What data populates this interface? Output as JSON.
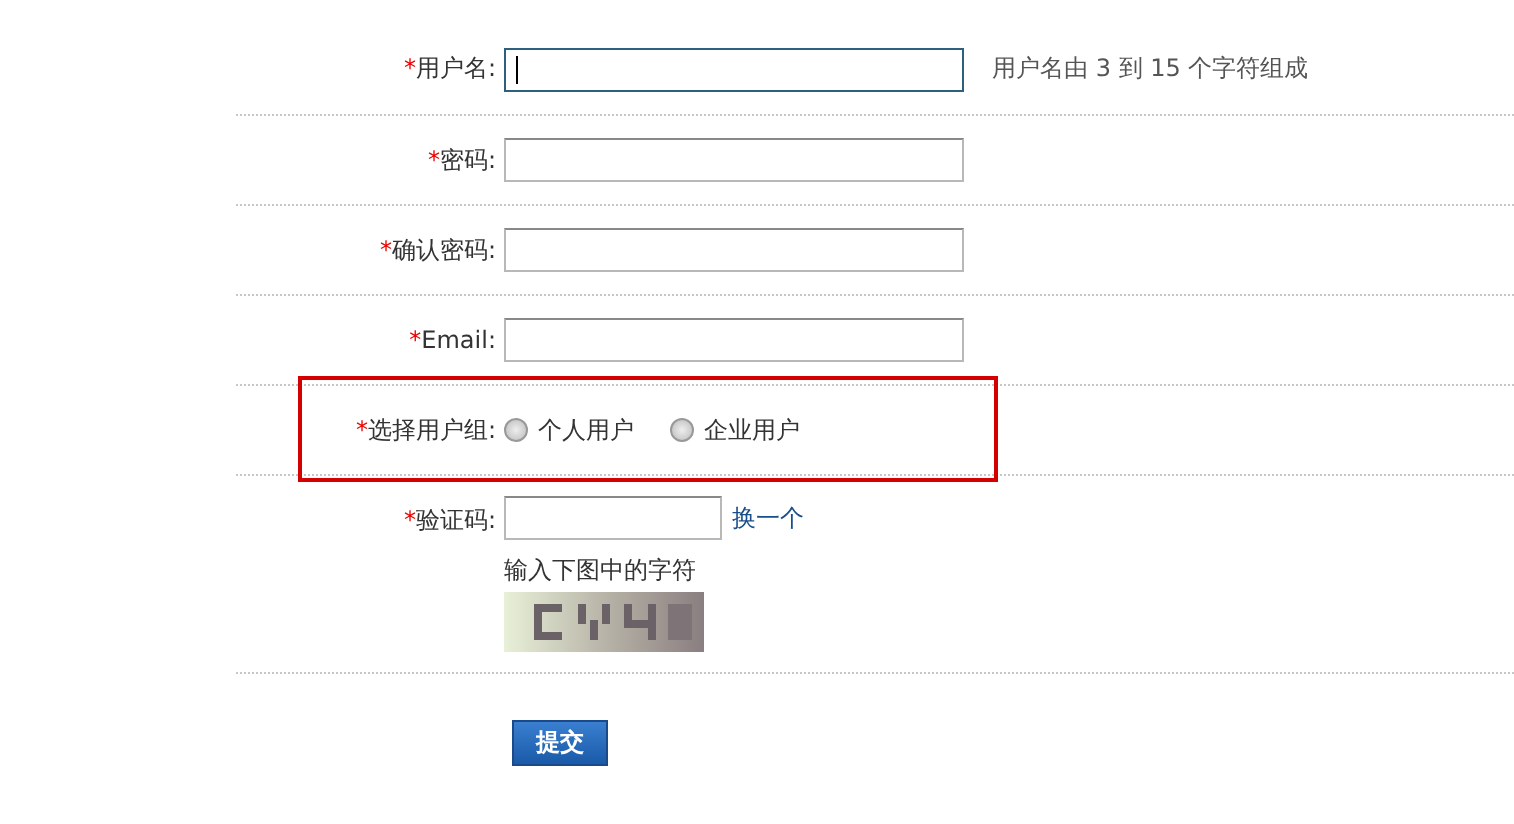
{
  "fields": [
    {
      "kind": "text",
      "label": "用户名:",
      "required_mark": "*",
      "focused": true,
      "hint": "用户名由 3 到 15 个字符组成"
    },
    {
      "kind": "text",
      "label": "密码:",
      "required_mark": "*",
      "focused": false
    },
    {
      "kind": "text",
      "label": "确认密码:",
      "required_mark": "*",
      "focused": false
    },
    {
      "kind": "text",
      "label": "Email:",
      "required_mark": "*",
      "focused": false
    },
    {
      "kind": "radio",
      "label": "选择用户组:",
      "required_mark": "*",
      "highlighted": true,
      "options": [
        {
          "label": "个人用户",
          "selected": false
        },
        {
          "label": "企业用户",
          "selected": false
        }
      ]
    },
    {
      "kind": "captcha",
      "label": "验证码:",
      "required_mark": "*",
      "focused": false,
      "link": "换一个",
      "note": "输入下图中的字符"
    }
  ],
  "submit": "提交"
}
